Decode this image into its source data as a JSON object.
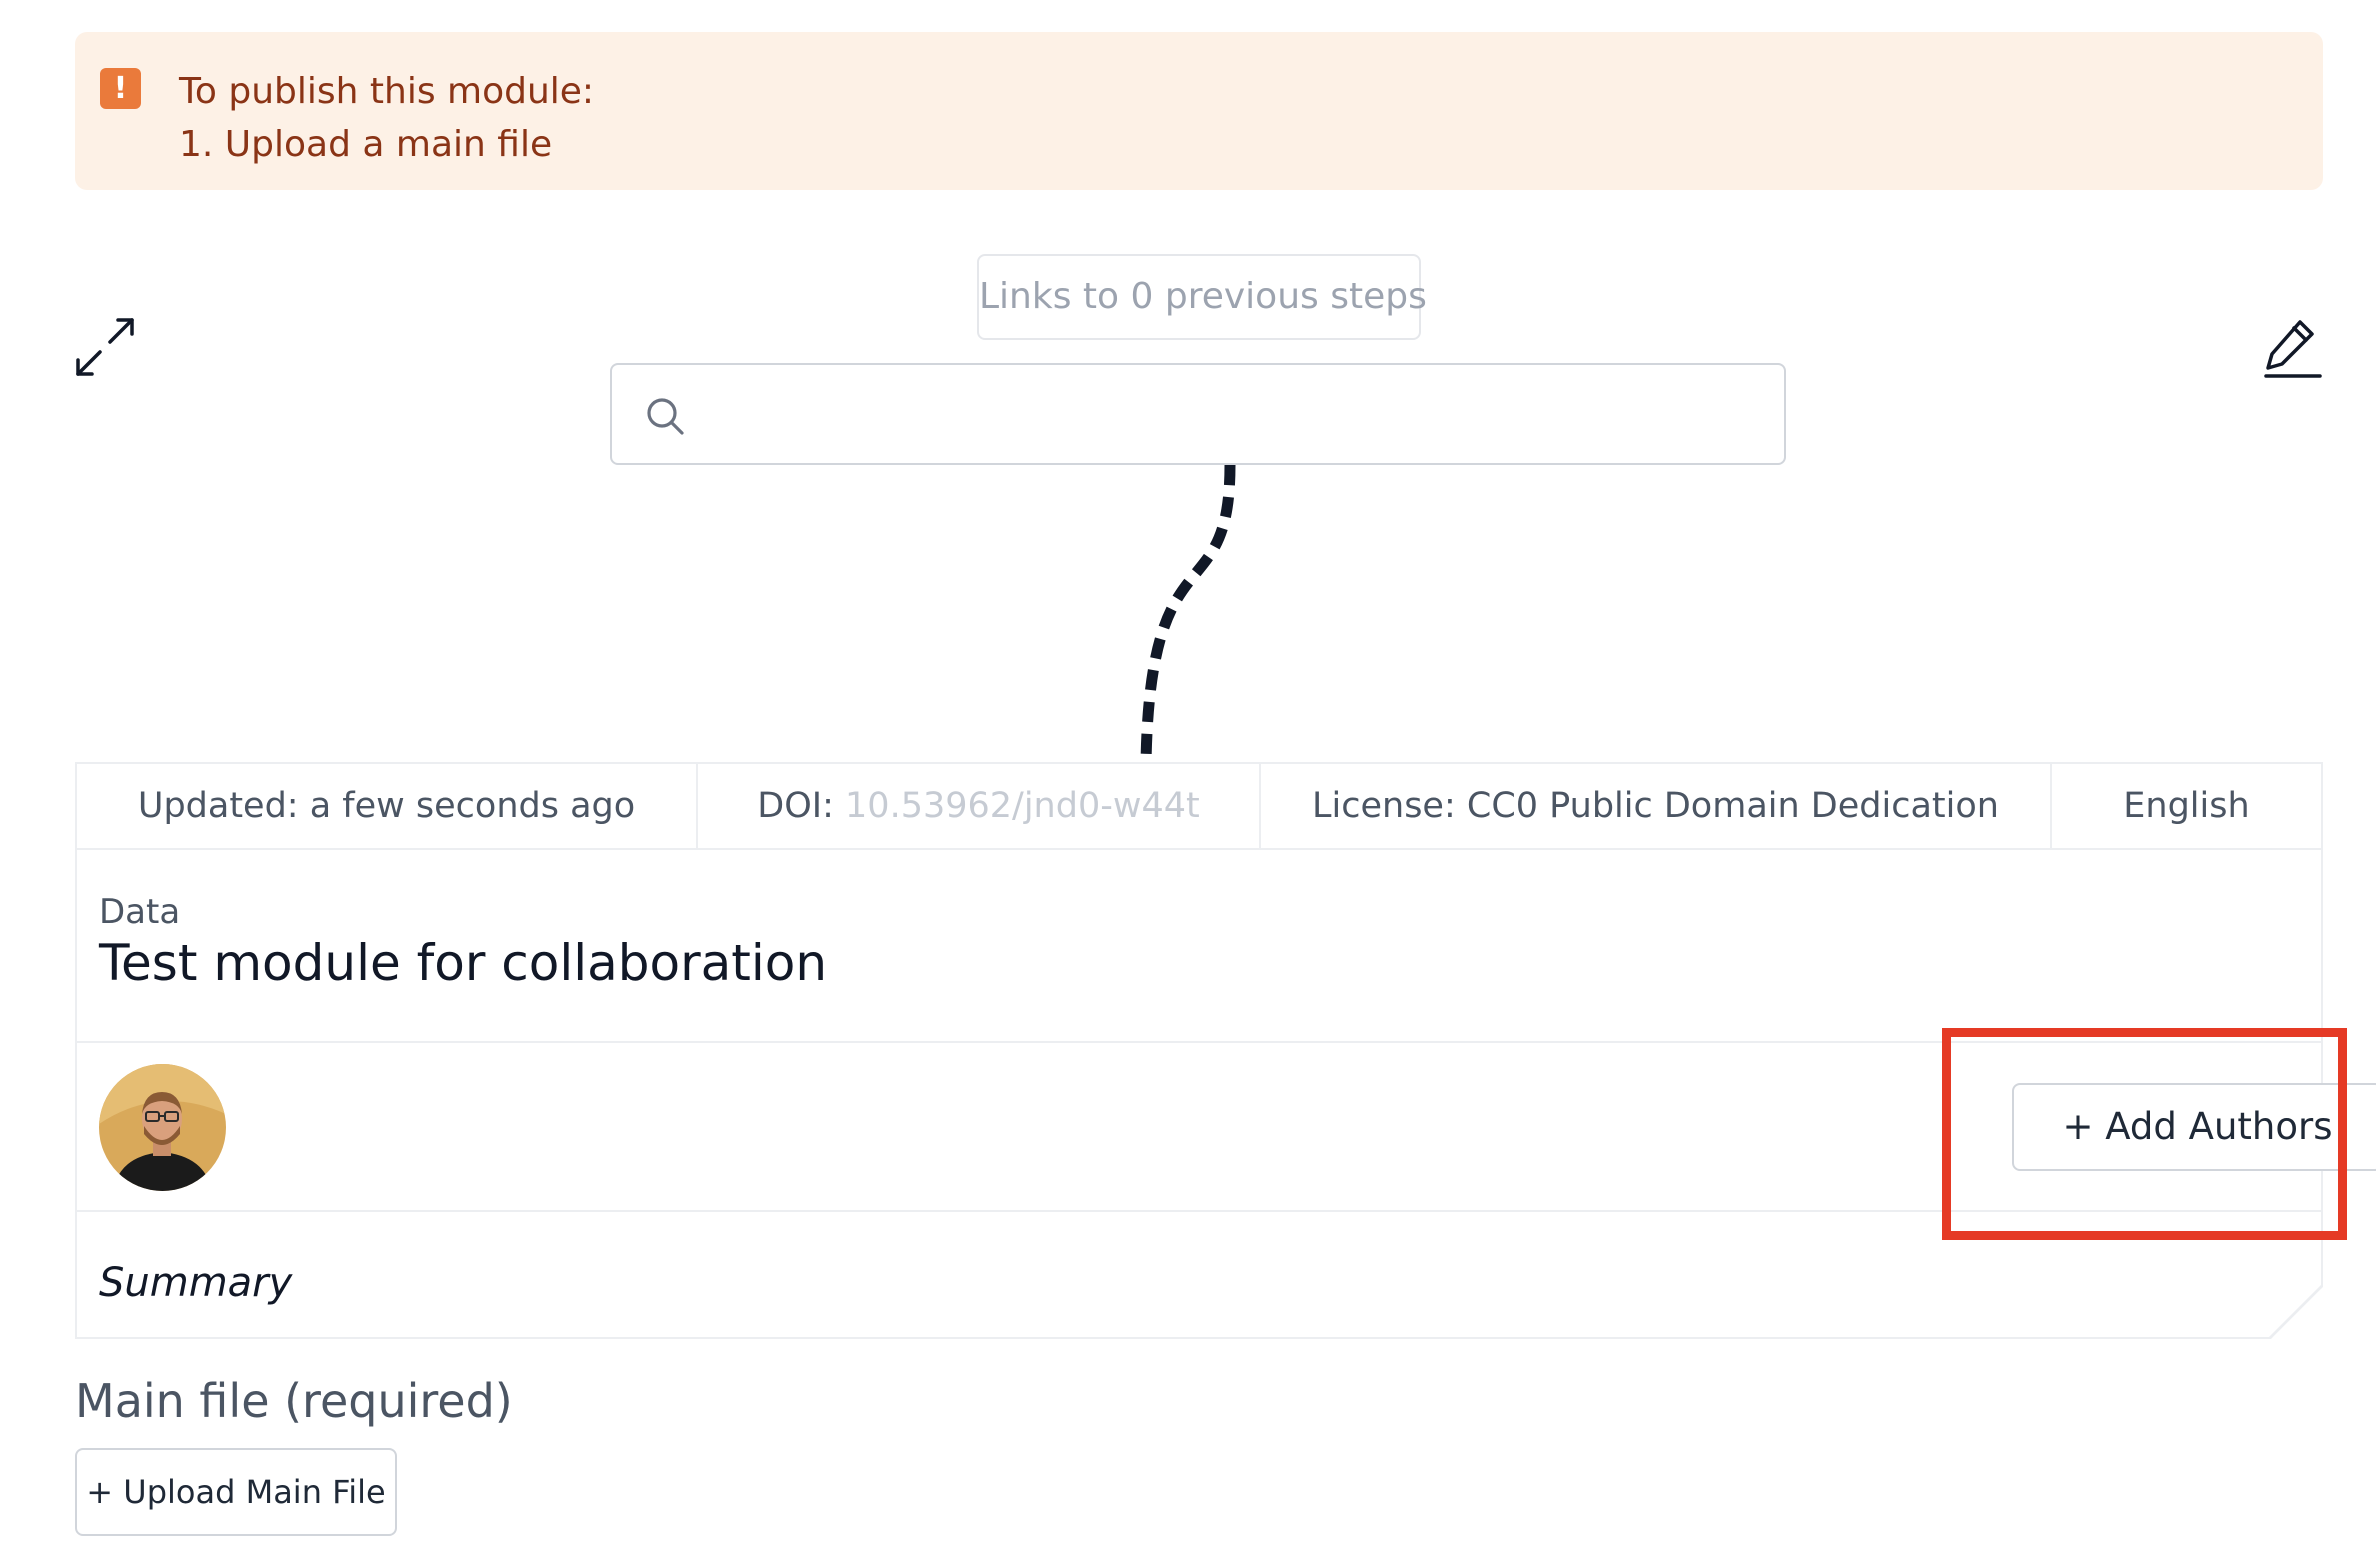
{
  "alert": {
    "title": "To publish this module:",
    "steps": [
      "1. Upload a main file"
    ],
    "accent_color": "#ea7a3b",
    "text_color": "#8a3416",
    "background_color": "#fdf1e6"
  },
  "graph": {
    "links_label": "Links to 0 previous steps",
    "search": {
      "value": "",
      "placeholder": ""
    },
    "expand_icon": "expand-arrows-icon",
    "edit_icon": "pencil-icon"
  },
  "module": {
    "meta": {
      "updated": "Updated: a few seconds ago",
      "doi_label": "DOI:",
      "doi_value": "10.53962/jnd0-w44t",
      "license": "License: CC0 Public Domain Dedication",
      "language": "English"
    },
    "type": "Data",
    "title": "Test module for collaboration",
    "add_authors_label": "+ Add Authors",
    "summary_placeholder": "Summary"
  },
  "main_file": {
    "heading": "Main file (required)",
    "upload_label": "+ Upload Main File"
  },
  "highlight_color": "#e53a25"
}
